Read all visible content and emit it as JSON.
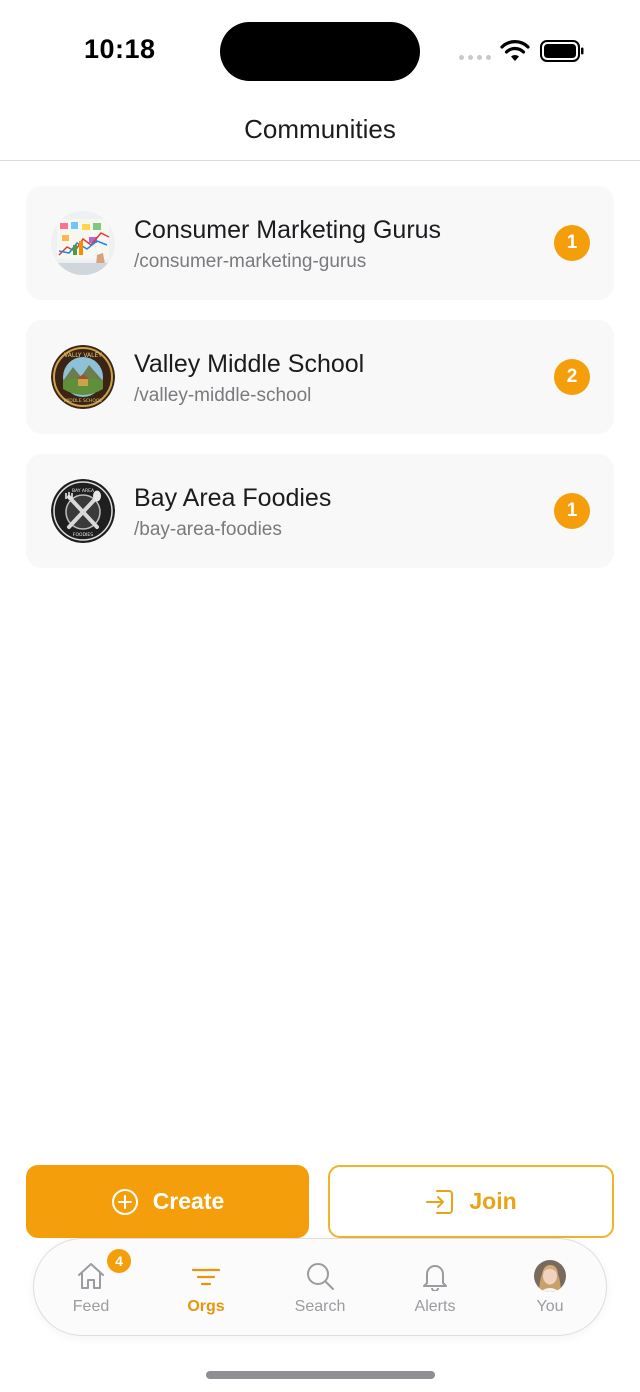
{
  "status": {
    "time": "10:18"
  },
  "header": {
    "title": "Communities"
  },
  "communities": [
    {
      "name": "Consumer Marketing Gurus",
      "slug": "/consumer-marketing-gurus",
      "count": "1",
      "icon": "marketing-board-avatar"
    },
    {
      "name": "Valley Middle School",
      "slug": "/valley-middle-school",
      "count": "2",
      "icon": "school-crest-avatar"
    },
    {
      "name": "Bay Area Foodies",
      "slug": "/bay-area-foodies",
      "count": "1",
      "icon": "fork-spoon-avatar"
    }
  ],
  "actions": {
    "create_label": "Create",
    "join_label": "Join"
  },
  "tabbar": {
    "feed": {
      "label": "Feed",
      "badge": "4"
    },
    "orgs": {
      "label": "Orgs"
    },
    "search": {
      "label": "Search"
    },
    "alerts": {
      "label": "Alerts"
    },
    "you": {
      "label": "You"
    }
  },
  "colors": {
    "accent": "#f59e0b",
    "accent_text": "#e8950c",
    "muted": "#9b9ba0"
  }
}
